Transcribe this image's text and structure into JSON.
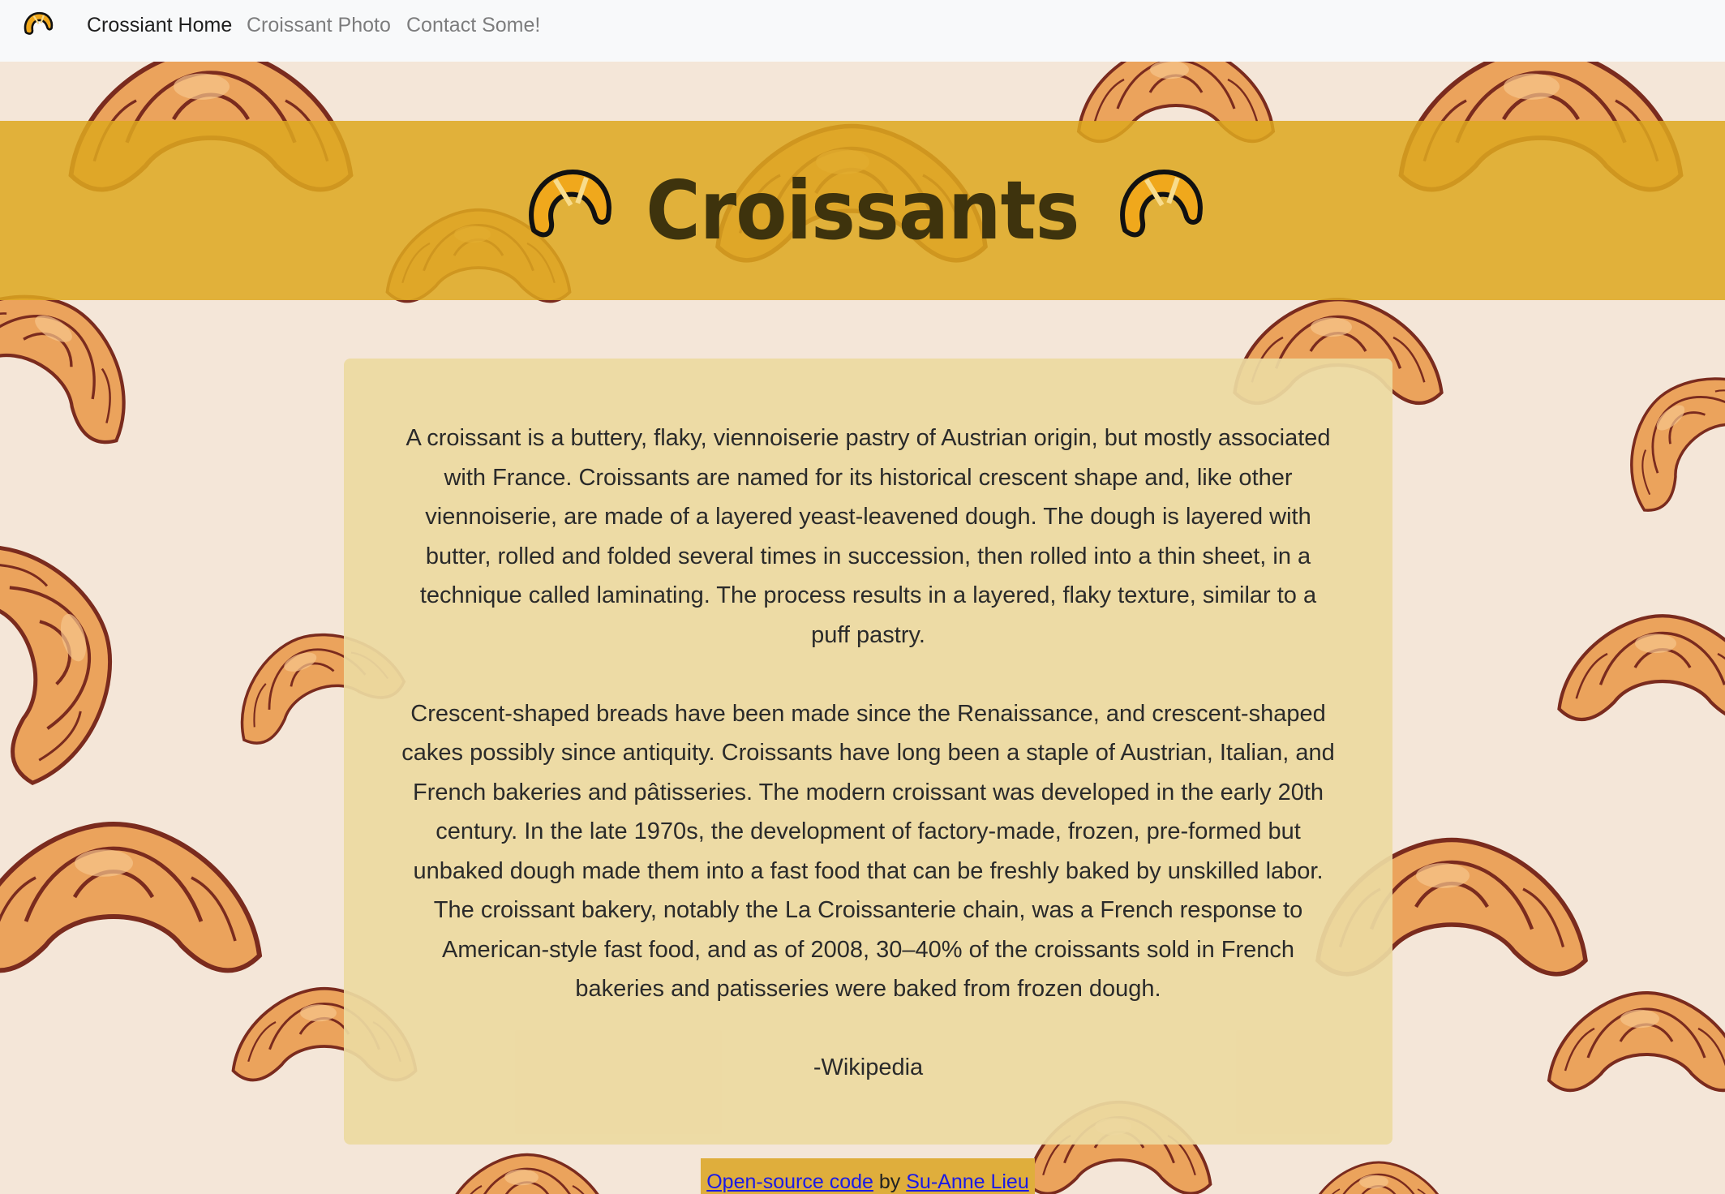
{
  "navbar": {
    "logo_icon": "croissant-icon",
    "links": [
      {
        "label": "Crossiant Home",
        "active": true
      },
      {
        "label": "Croissant Photo",
        "active": false
      },
      {
        "label": "Contact Some!",
        "active": false
      }
    ]
  },
  "header": {
    "title": "Croissants",
    "icon": "croissant-icon"
  },
  "main": {
    "paragraphs": [
      "A croissant is a buttery, flaky, viennoiserie pastry of Austrian origin, but mostly associated with France. Croissants are named for its historical crescent shape and, like other viennoiserie, are made of a layered yeast-leavened dough. The dough is layered with butter, rolled and folded several times in succession, then rolled into a thin sheet, in a technique called laminating. The process results in a layered, flaky texture, similar to a puff pastry.",
      "Crescent-shaped breads have been made since the Renaissance, and crescent-shaped cakes possibly since antiquity. Croissants have long been a staple of Austrian, Italian, and French bakeries and pâtisseries. The modern croissant was developed in the early 20th century. In the late 1970s, the development of factory-made, frozen, pre-formed but unbaked dough made them into a fast food that can be freshly baked by unskilled labor. The croissant bakery, notably the La Croissanterie chain, was a French response to American-style fast food, and as of 2008, 30–40% of the croissants sold in French bakeries and patisseries were baked from frozen dough.",
      "-Wikipedia"
    ]
  },
  "footer": {
    "code_link": "Open-source code",
    "by_text": "by",
    "author_link": "Su-Anne Lieu"
  },
  "colors": {
    "navbar_bg": "#f8f9fa",
    "banner": "#dda820",
    "card": "#ecd9a0",
    "page_bg": "#f4e6d8",
    "link": "#1a1ae6"
  }
}
